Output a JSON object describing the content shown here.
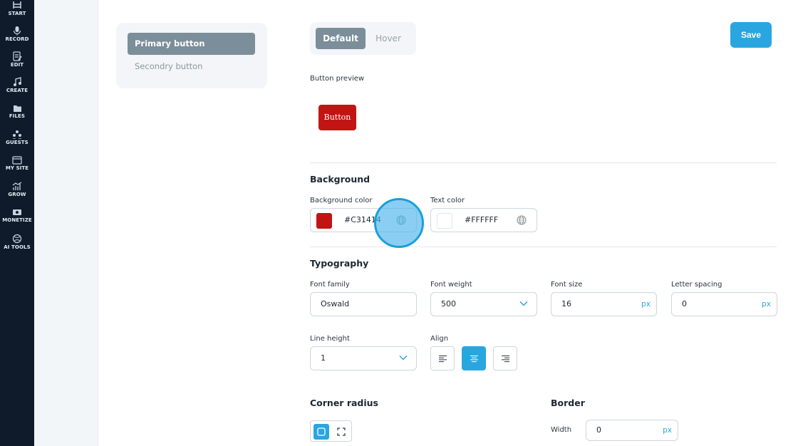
{
  "sidebar": {
    "items": [
      {
        "label": "START",
        "icon": "start-icon"
      },
      {
        "label": "RECORD",
        "icon": "microphone-icon"
      },
      {
        "label": "EDIT",
        "icon": "edit-icon"
      },
      {
        "label": "CREATE",
        "icon": "music-note-icon"
      },
      {
        "label": "FILES",
        "icon": "folder-icon"
      },
      {
        "label": "GUESTS",
        "icon": "users-icon"
      },
      {
        "label": "MY SITE",
        "icon": "browser-icon"
      },
      {
        "label": "GROW",
        "icon": "chart-icon"
      },
      {
        "label": "MONETIZE",
        "icon": "money-icon"
      },
      {
        "label": "AI TOOLS",
        "icon": "ai-globe-icon"
      }
    ]
  },
  "button_types": {
    "primary": "Primary button",
    "secondary": "Secondry button",
    "selected": "primary"
  },
  "state_tabs": {
    "default": "Default",
    "hover": "Hover",
    "selected": "default"
  },
  "toolbar": {
    "save_label": "Save"
  },
  "preview": {
    "label": "Button preview",
    "button_text": "Button",
    "background_color": "#C31414",
    "text_color": "#FFFFFF"
  },
  "background": {
    "title": "Background",
    "bg_color_label": "Background color",
    "bg_color_value": "#C31414",
    "text_color_label": "Text color",
    "text_color_value": "#FFFFFF"
  },
  "typography": {
    "title": "Typography",
    "font_family_label": "Font family",
    "font_family_value": "Oswald",
    "font_weight_label": "Font weight",
    "font_weight_value": "500",
    "font_size_label": "Font size",
    "font_size_value": "16",
    "font_size_unit": "px",
    "letter_spacing_label": "Letter spacing",
    "letter_spacing_value": "0",
    "letter_spacing_unit": "px",
    "line_height_label": "Line height",
    "line_height_value": "1",
    "align_label": "Align",
    "align_selected": "center"
  },
  "corner_radius": {
    "title": "Corner radius",
    "selected": "rounded"
  },
  "border": {
    "title": "Border",
    "width_label": "Width",
    "width_value": "0",
    "width_unit": "px"
  },
  "colors": {
    "accent": "#29A6E0",
    "sidebar_bg": "#0F1B2A",
    "selected_gray": "#7B8E99"
  }
}
